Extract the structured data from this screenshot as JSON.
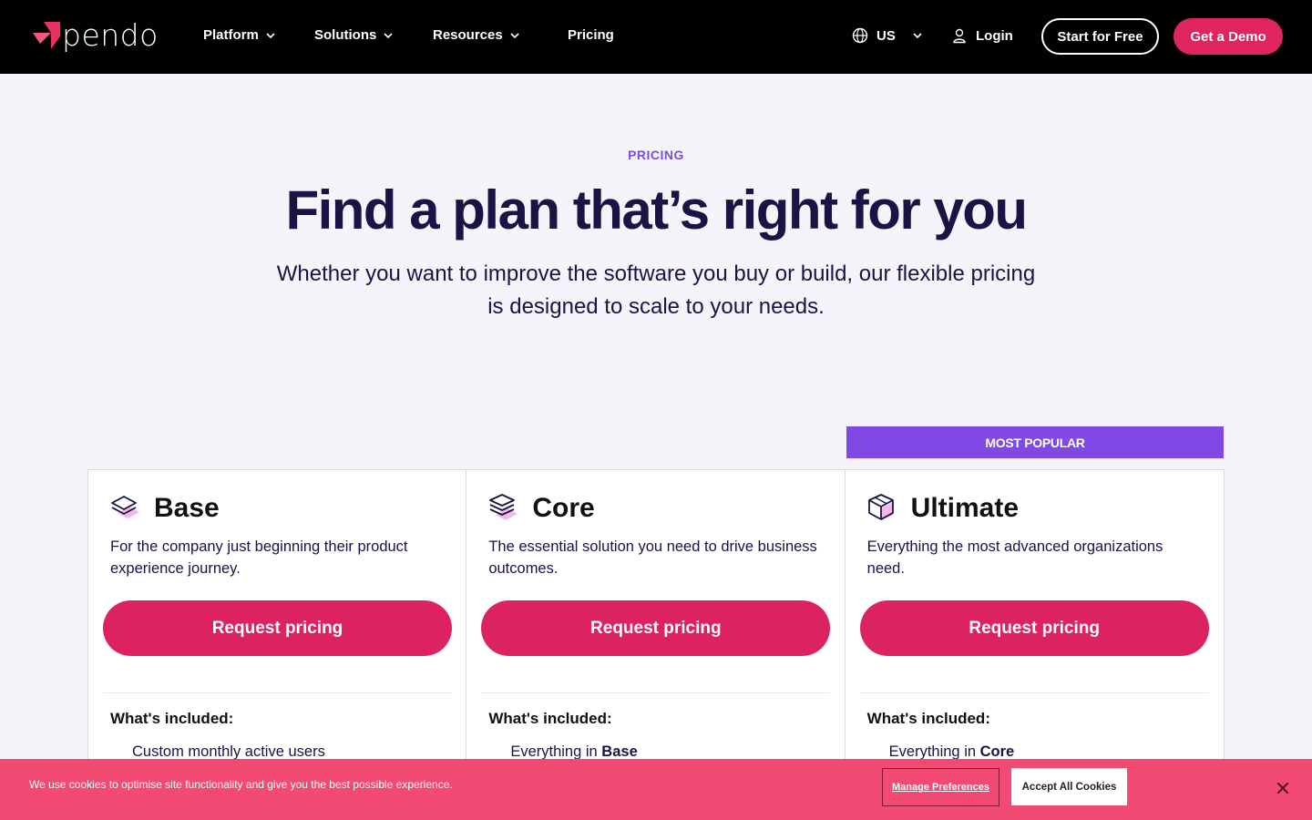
{
  "brand": {
    "name": "pendo",
    "accent": "#e0245e",
    "purple": "#8049e6"
  },
  "nav": {
    "items": [
      {
        "label": "Platform",
        "has_dropdown": true
      },
      {
        "label": "Solutions",
        "has_dropdown": true
      },
      {
        "label": "Resources",
        "has_dropdown": true
      },
      {
        "label": "Pricing",
        "has_dropdown": false
      }
    ],
    "region": "US",
    "login": "Login",
    "start_free": "Start for Free",
    "get_demo": "Get a Demo"
  },
  "hero": {
    "eyebrow": "PRICING",
    "title": "Find a plan that’s right for you",
    "subtitle": "Whether you want to improve the software you buy or build, our flexible pricing is designed to scale to your needs."
  },
  "plans": {
    "badge": "MOST POPULAR",
    "items": [
      {
        "name": "Base",
        "icon": "layers-icon",
        "description": "For the company just beginning their product experience journey.",
        "cta": "Request pricing",
        "included_title": "What's included:",
        "first_item_prefix": "Custom monthly active users",
        "first_item_bold": ""
      },
      {
        "name": "Core",
        "icon": "stack-icon",
        "description": "The essential solution you need to drive business outcomes.",
        "cta": "Request pricing",
        "included_title": "What's included:",
        "first_item_prefix": "Everything in ",
        "first_item_bold": "Base"
      },
      {
        "name": "Ultimate",
        "icon": "cube-icon",
        "description": "Everything the most advanced organizations need.",
        "cta": "Request pricing",
        "included_title": "What's included:",
        "first_item_prefix": "Everything in ",
        "first_item_bold": "Core"
      }
    ]
  },
  "cookie": {
    "text": "We use cookies to optimise site functionality and give you the best possible experience.",
    "manage": "Manage Preferences",
    "accept": "Accept All Cookies"
  }
}
